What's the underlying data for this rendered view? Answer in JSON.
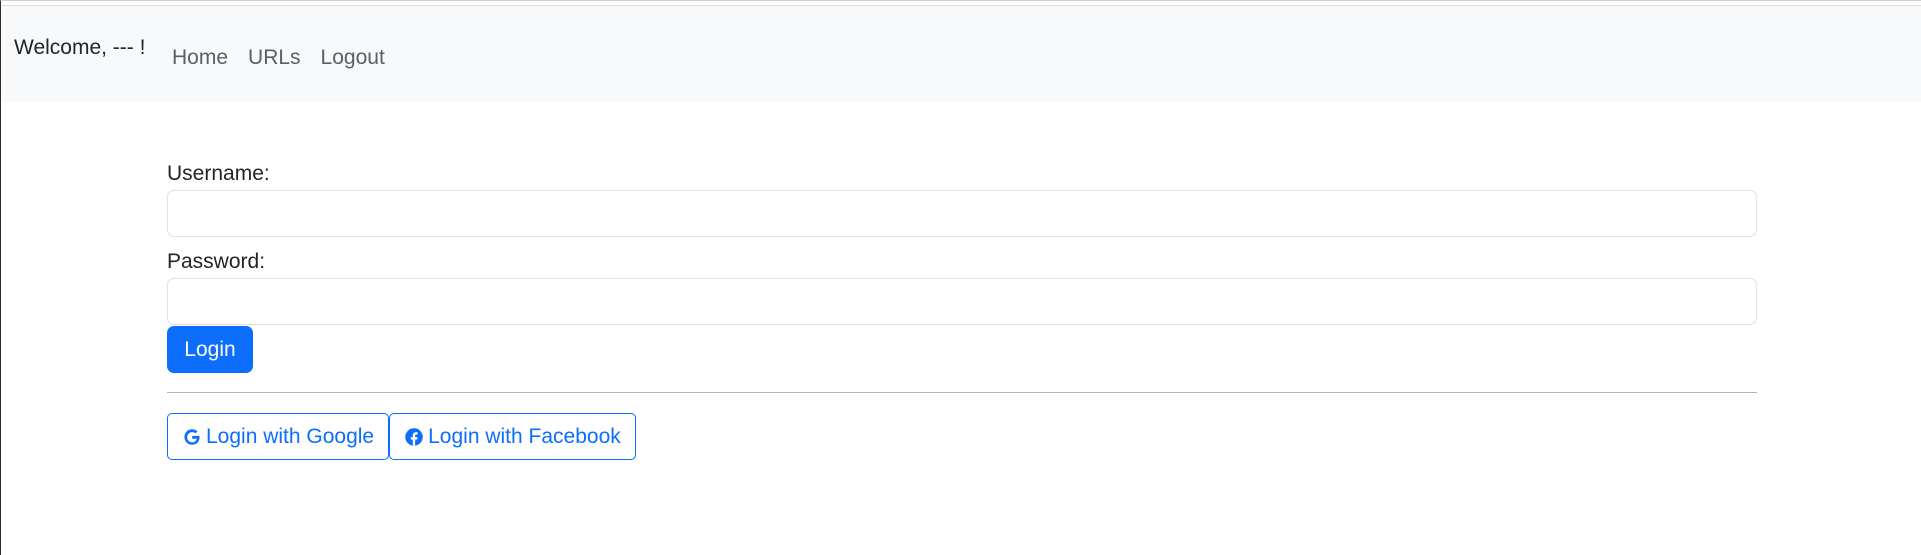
{
  "navbar": {
    "welcome_text": "Welcome, --- !",
    "links": [
      {
        "label": "Home"
      },
      {
        "label": "URLs"
      },
      {
        "label": "Logout"
      }
    ]
  },
  "login_form": {
    "username_label": "Username:",
    "username_value": "",
    "password_label": "Password:",
    "password_value": "",
    "login_button": "Login"
  },
  "social_login": {
    "google": {
      "label": "Login with Google",
      "icon": "google-icon"
    },
    "facebook": {
      "label": "Login with Facebook",
      "icon": "facebook-icon"
    }
  },
  "colors": {
    "primary": "#0d6efd",
    "navbar_bg": "#f8f9fa",
    "divider": "#adb5bd"
  }
}
